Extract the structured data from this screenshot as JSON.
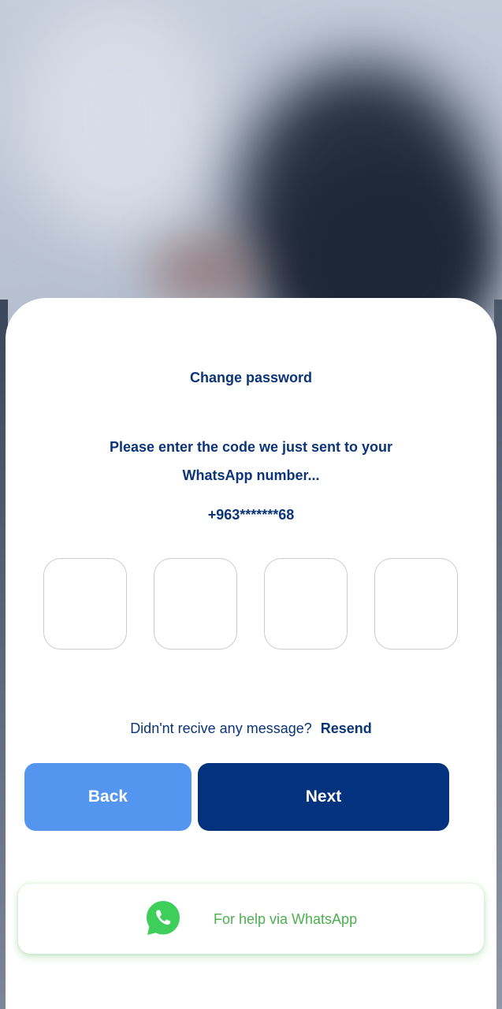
{
  "screen": {
    "title": "Change password",
    "instruction_line1": "Please enter the code we just sent to your",
    "instruction_line2": "WhatsApp number...",
    "phone_masked": "+963*******68"
  },
  "otp": {
    "digits": [
      "",
      "",
      "",
      ""
    ]
  },
  "resend": {
    "question": "Didn'nt recive any message?",
    "link_label": "Resend"
  },
  "buttons": {
    "back_label": "Back",
    "next_label": "Next"
  },
  "help": {
    "label": "For help via WhatsApp",
    "icon": "whatsapp-icon"
  },
  "colors": {
    "primary": "#03327f",
    "secondary": "#5496ef",
    "text": "#0c3478",
    "whatsapp": "#4caf50"
  }
}
